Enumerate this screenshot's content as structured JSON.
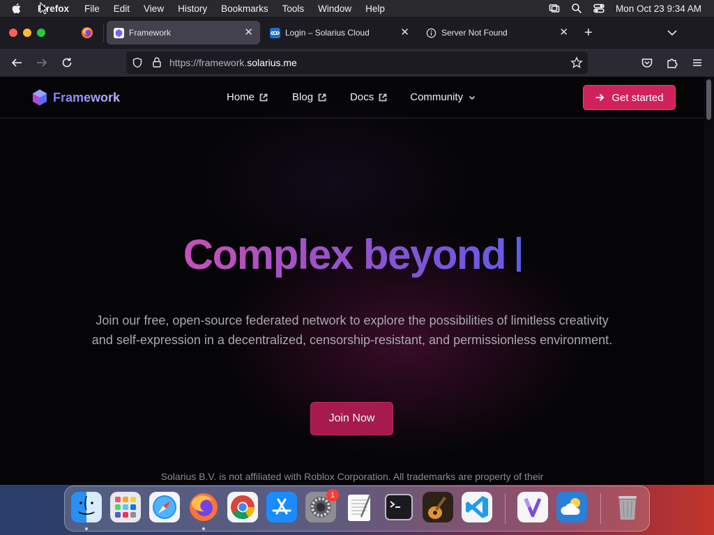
{
  "menubar": {
    "app_name": "Firefox",
    "items": [
      "File",
      "Edit",
      "View",
      "History",
      "Bookmarks",
      "Tools",
      "Window",
      "Help"
    ],
    "clock": "Mon Oct 23  9:34 AM"
  },
  "tabs": [
    {
      "title": "Framework",
      "active": true
    },
    {
      "title": "Login – Solarius Cloud",
      "active": false
    },
    {
      "title": "Server Not Found",
      "active": false
    }
  ],
  "urlbar": {
    "url_prefix": "https://framework.",
    "url_host": "solarius.me"
  },
  "site": {
    "logo_text": "Framework",
    "nav": {
      "home": "Home",
      "blog": "Blog",
      "docs": "Docs",
      "community": "Community"
    },
    "cta_label": "Get started",
    "hero_title": "Complex beyond",
    "hero_subtitle": "Join our free, open-source federated network to explore the possibilities of limitless creativity and self-expression in a decentralized, censorship-resistant, and permissionless environment.",
    "join_label": "Join Now",
    "footer_note": "Solarius B.V. is not affiliated with Roblox Corporation. All trademarks are property of their",
    "colors": {
      "cta": "#d0215b",
      "join": "#a61a4e",
      "title_gradient_start": "#c84fb8",
      "title_gradient_end": "#6a5ae6"
    }
  },
  "dock": {
    "apps": [
      "finder-icon",
      "launchpad-icon",
      "safari-icon",
      "firefox-icon",
      "chrome-icon",
      "app-store-icon",
      "system-settings-icon",
      "textedit-icon",
      "terminal-icon",
      "garageband-icon",
      "vscode-icon",
      "visual-studio-icon",
      "weather-icon",
      "trash-icon"
    ],
    "settings_badge": "1"
  }
}
